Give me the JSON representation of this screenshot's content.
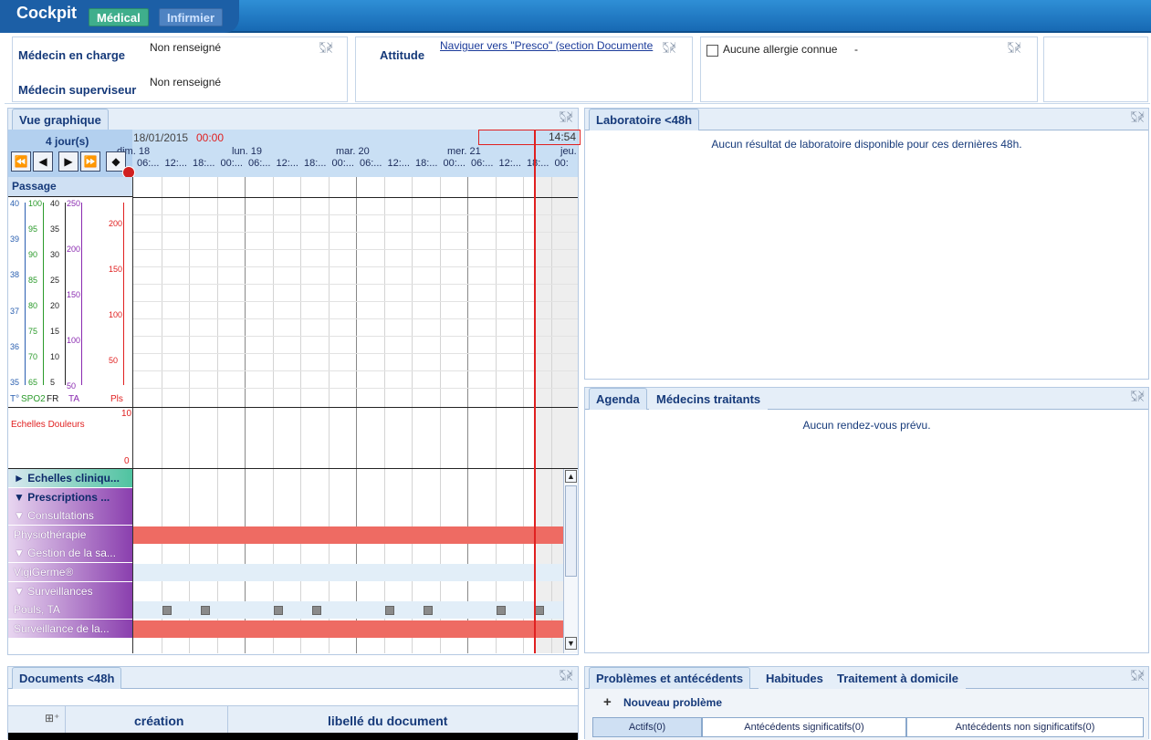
{
  "header": {
    "app_title": "Cockpit",
    "tab_medical": "Médical",
    "tab_infirmier": "Infirmier"
  },
  "info": {
    "medecin_charge_label": "Médecin en charge",
    "medecin_charge_value": "Non renseigné",
    "medecin_superviseur_label": "Médecin superviseur",
    "medecin_superviseur_value": "Non renseigné",
    "attitude_label": "Attitude",
    "attitude_link": "Naviguer vers \"Presco\" (section Documente",
    "allergie_label": "Aucune allergie connue",
    "allergie_dash": "-"
  },
  "graph": {
    "tab": "Vue graphique",
    "period": "4 jour(s)",
    "start_date": "18/01/2015",
    "start_time": "00:00",
    "now_time": "14:54",
    "days": [
      "dim. 18",
      "lun. 19",
      "mar. 20",
      "mer. 21",
      "jeu."
    ],
    "hours": [
      "06:...",
      "12:...",
      "18:...",
      "00:...",
      "06:...",
      "12:...",
      "18:...",
      "00:...",
      "06:...",
      "12:...",
      "18:...",
      "00:...",
      "06:...",
      "12:...",
      "18:...",
      "00:"
    ],
    "passage": "Passage",
    "axis_t": [
      "40",
      "39",
      "38",
      "37",
      "36",
      "35"
    ],
    "axis_spo2": [
      "100",
      "95",
      "90",
      "85",
      "80",
      "75",
      "70",
      "65"
    ],
    "axis_fr": [
      "40",
      "35",
      "30",
      "25",
      "20",
      "15",
      "10",
      "5"
    ],
    "axis_ta": [
      "250",
      "200",
      "150",
      "100",
      "50"
    ],
    "axis_pls": [
      "200",
      "150",
      "100",
      "50"
    ],
    "legend": [
      "T°",
      "SPO2",
      "FR",
      "TA",
      "Pls"
    ],
    "douleur_label": "Echelles Douleurs",
    "douleur_max": "10",
    "douleur_min": "0",
    "tree": [
      "► Echelles cliniqu...",
      "▼ Prescriptions ...",
      "▼ Consultations",
      "Physiothérapie",
      "▼ Gestion de la sa...",
      "VigiGerme®",
      "▼ Surveillances",
      "Pouls, TA",
      "Surveillance de la..."
    ]
  },
  "nav_buttons": [
    "⏪",
    "◀",
    "▶",
    "⏩",
    "◆"
  ],
  "lab": {
    "tab": "Laboratoire <48h",
    "message": "Aucun résultat de laboratoire disponible pour ces dernières 48h."
  },
  "agenda": {
    "tab1": "Agenda",
    "tab2": "Médecins traitants",
    "message": "Aucun rendez-vous prévu."
  },
  "documents": {
    "tab": "Documents <48h",
    "col_creation": "création",
    "col_libelle": "libellé du document"
  },
  "problemes": {
    "tab1": "Problèmes et antécédents",
    "tab2": "Habitudes",
    "tab3": "Traitement à domicile",
    "new": "Nouveau problème",
    "sub1": "Actifs(0)",
    "sub2": "Antécédents significatifs(0)",
    "sub3": "Antécédents non significatifs(0)"
  }
}
